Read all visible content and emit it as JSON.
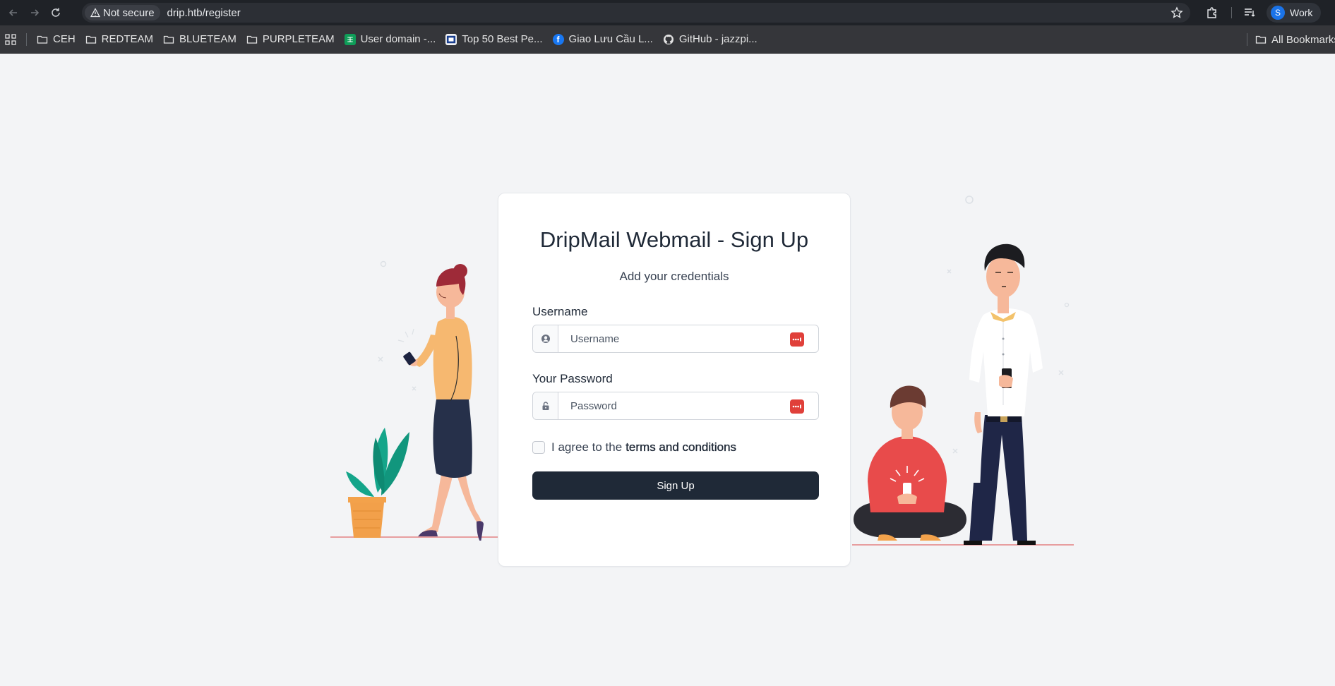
{
  "browser": {
    "not_secure_label": "Not secure",
    "url": "drip.htb/register",
    "profile_initial": "S",
    "profile_name": "Work"
  },
  "bookmarks": [
    {
      "label": "CEH",
      "icon": "folder-icon"
    },
    {
      "label": "REDTEAM",
      "icon": "folder-icon"
    },
    {
      "label": "BLUETEAM",
      "icon": "folder-icon"
    },
    {
      "label": "PURPLETEAM",
      "icon": "folder-icon"
    },
    {
      "label": "User domain -...",
      "icon": "sheets-icon"
    },
    {
      "label": "Top 50 Best Pe...",
      "icon": "site-icon"
    },
    {
      "label": "Giao Lưu Cầu L...",
      "icon": "facebook-icon"
    },
    {
      "label": "GitHub - jazzpi...",
      "icon": "github-icon"
    }
  ],
  "all_bookmarks_label": "All Bookmarks",
  "form": {
    "title": "DripMail Webmail - Sign Up",
    "subtitle": "Add your credentials",
    "username_label": "Username",
    "username_placeholder": "Username",
    "username_value": "",
    "password_label": "Your Password",
    "password_placeholder": "Password",
    "password_value": "",
    "terms_prefix": "I agree to the",
    "terms_link": "terms and conditions",
    "terms_checked": false,
    "submit_label": "Sign Up"
  },
  "colors": {
    "page_bg": "#f3f4f6",
    "primary_button": "#1f2937",
    "password_manager_icon": "#e0403a"
  }
}
